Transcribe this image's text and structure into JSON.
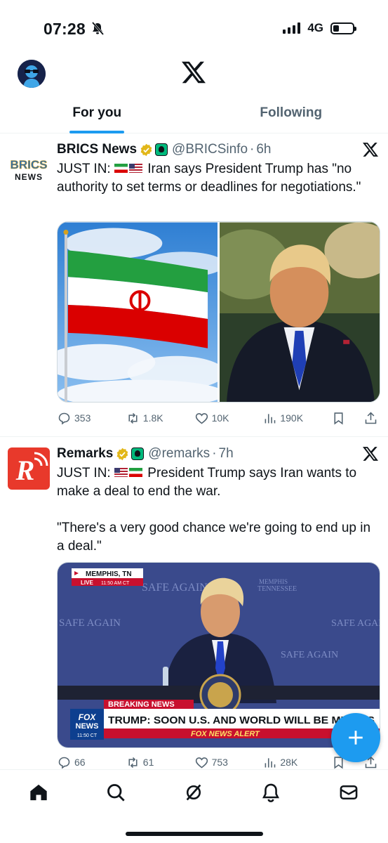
{
  "status_bar": {
    "time": "07:28",
    "network": "4G"
  },
  "header": {
    "tabs": [
      {
        "label": "For you"
      },
      {
        "label": "Following"
      }
    ]
  },
  "tweets": [
    {
      "name": "BRICS News",
      "handle": "@BRICSinfo",
      "separator": "·",
      "time": "6h",
      "prefix": "JUST IN:",
      "text": "Iran says President Trump has \"no authority to set terms or deadlines for negotiations.\"",
      "flags": [
        "iran-flag",
        "usa-flag"
      ],
      "avatar_text": {
        "line1": "BRICS",
        "line2": "NEWS"
      },
      "metrics": {
        "replies": "353",
        "reposts": "1.8K",
        "likes": "10K",
        "views": "190K"
      }
    },
    {
      "name": "Remarks",
      "handle": "@remarks",
      "separator": "·",
      "time": "7h",
      "prefix": "JUST IN:",
      "text": "President Trump says Iran wants to make a deal to end the war.",
      "quote": "\"There's a very good chance we're going to end up in a deal.\"",
      "flags": [
        "usa-flag",
        "iran-flag"
      ],
      "avatar_text": {
        "letter": "R"
      },
      "metrics": {
        "replies": "66",
        "reposts": "61",
        "likes": "753",
        "views": "28K"
      },
      "media_overlay": {
        "location": "MEMPHIS, TN",
        "live": "LIVE",
        "live_time": "11:50 AM CT",
        "breaking": "BREAKING NEWS",
        "ticker": "TRUMP: SOON U.S. AND WORLD WILL BE MUCH S",
        "alert": "FOX NEWS ALERT",
        "logo_line1": "FOX",
        "logo_line2": "NEWS",
        "logo_time": "11:50 CT",
        "backdrop_1": "SAFE AGAIN",
        "backdrop_2": "MEMPHIS",
        "backdrop_3": "TENNESSEE"
      }
    }
  ],
  "colors": {
    "accent": "#1d9bf0",
    "text": "#0f1419",
    "secondary": "#536471",
    "verified_gold": "#e2b719"
  },
  "icons": {
    "nav": [
      "home-icon",
      "search-icon",
      "grok-icon",
      "notifications-icon",
      "messages-icon"
    ],
    "actions": [
      "reply-icon",
      "repost-icon",
      "like-icon",
      "views-icon",
      "bookmark-icon",
      "share-icon"
    ]
  }
}
